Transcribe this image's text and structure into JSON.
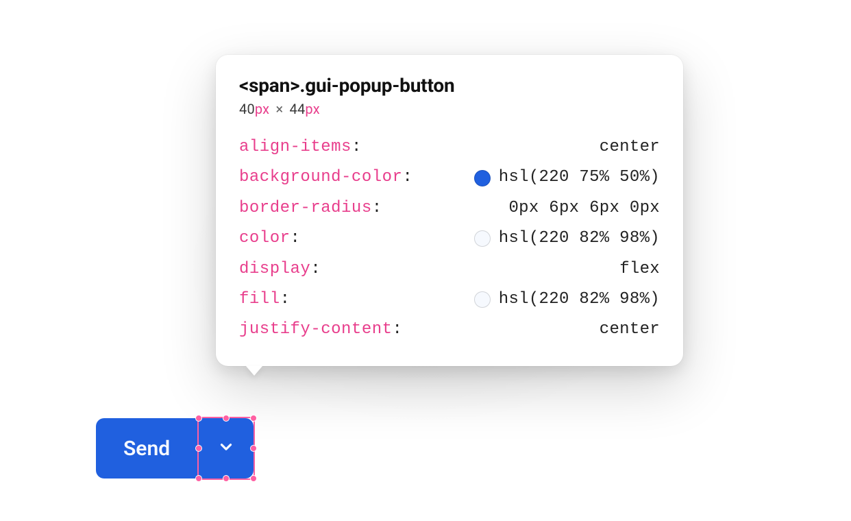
{
  "tooltip": {
    "selector_tag": "<span>",
    "selector_class": ".gui-popup-button",
    "dims": {
      "w": "40",
      "w_unit": "px",
      "sep": "×",
      "h": "44",
      "h_unit": "px"
    },
    "props": [
      {
        "name": "align-items",
        "value": "center",
        "swatch": null
      },
      {
        "name": "background-color",
        "value": "hsl(220 75% 50%)",
        "swatch": "hsl(220 75% 50%)"
      },
      {
        "name": "border-radius",
        "value": "0px 6px 6px 0px",
        "swatch": null
      },
      {
        "name": "color",
        "value": "hsl(220 82% 98%)",
        "swatch": "hsl(220 82% 98%)"
      },
      {
        "name": "display",
        "value": "flex",
        "swatch": null
      },
      {
        "name": "fill",
        "value": "hsl(220 82% 98%)",
        "swatch": "hsl(220 82% 98%)"
      },
      {
        "name": "justify-content",
        "value": "center",
        "swatch": null
      }
    ]
  },
  "button": {
    "main_label": "Send"
  },
  "colors": {
    "accent": "hsl(220 75% 50%)",
    "on_accent": "hsl(220 82% 98%)",
    "pink": "#ff5fa2"
  }
}
